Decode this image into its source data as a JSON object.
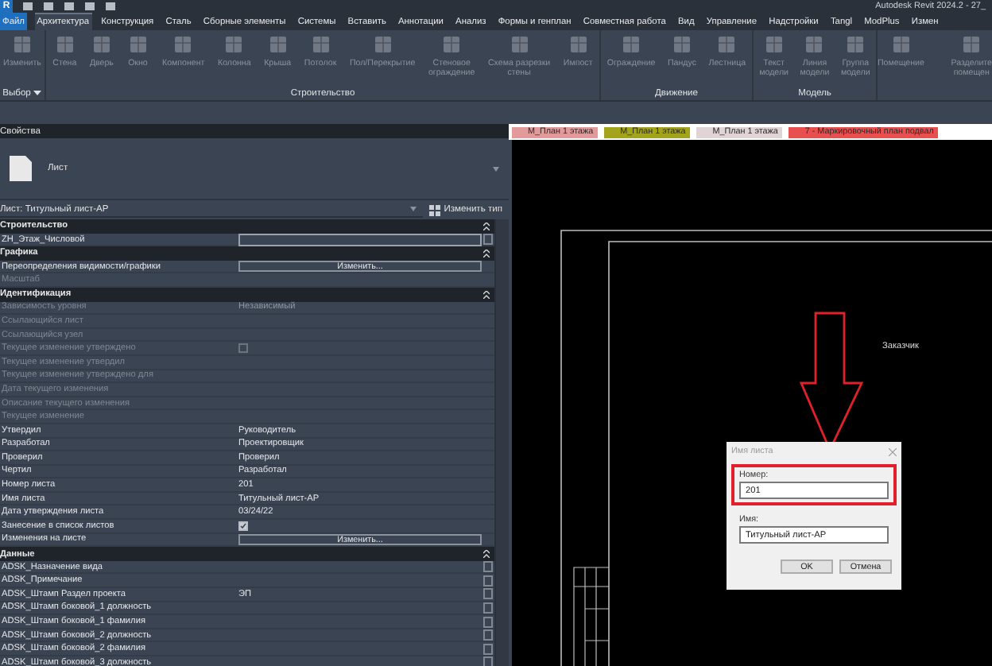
{
  "title_bar": {
    "logo": "R",
    "title": "Autodesk Revit 2024.2 - 27_"
  },
  "menu_tabs": [
    {
      "label": "Файл",
      "kind": "file",
      "selected": false
    },
    {
      "label": "Архитектура",
      "kind": "tab",
      "selected": true
    },
    {
      "label": "Конструкция",
      "kind": "tab",
      "selected": false
    },
    {
      "label": "Сталь",
      "kind": "tab",
      "selected": false
    },
    {
      "label": "Сборные элементы",
      "kind": "tab",
      "selected": false
    },
    {
      "label": "Системы",
      "kind": "tab",
      "selected": false
    },
    {
      "label": "Вставить",
      "kind": "tab",
      "selected": false
    },
    {
      "label": "Аннотации",
      "kind": "tab",
      "selected": false
    },
    {
      "label": "Анализ",
      "kind": "tab",
      "selected": false
    },
    {
      "label": "Формы и генплан",
      "kind": "tab",
      "selected": false
    },
    {
      "label": "Совместная работа",
      "kind": "tab",
      "selected": false
    },
    {
      "label": "Вид",
      "kind": "tab",
      "selected": false
    },
    {
      "label": "Управление",
      "kind": "tab",
      "selected": false
    },
    {
      "label": "Надстройки",
      "kind": "tab",
      "selected": false
    },
    {
      "label": "Tangl",
      "kind": "tab",
      "selected": false
    },
    {
      "label": "ModPlus",
      "kind": "tab",
      "selected": false
    },
    {
      "label": "Измен",
      "kind": "tab",
      "selected": false
    }
  ],
  "ribbon": {
    "panels": [
      {
        "label": "Выбор",
        "dropdown": true,
        "tools": [
          "Изменить"
        ]
      },
      {
        "label": "Строительство",
        "tools": [
          "Стена",
          "Дверь",
          "Окно",
          "Компонент",
          "Колонна",
          "Крыша",
          "Потолок",
          "Пол/Перекрытие",
          "Стеновое\nограждение",
          "Схема разрезки\nстены",
          "Импост"
        ]
      },
      {
        "label": "Движение",
        "tools": [
          "Ограждение",
          "Пандус",
          "Лестница"
        ]
      },
      {
        "label": "Модель",
        "tools": [
          "Текст\nмодели",
          "Линия\nмодели",
          "Группа\nмодели"
        ]
      },
      {
        "tools": [
          "Помещение",
          "Разделите\nпомещен"
        ]
      }
    ]
  },
  "properties": {
    "title": "Свойства",
    "type_name": "Лист",
    "instance_selector": "Лист: Титульный лист-АР",
    "edit_type": "Изменить тип",
    "rows": [
      {
        "kind": "section",
        "label": "Строительство"
      },
      {
        "kind": "input",
        "label": "ZH_Этаж_Числовой",
        "disabled": false
      },
      {
        "kind": "section",
        "label": "Графика"
      },
      {
        "kind": "button",
        "label": "Переопределения видимости/графики",
        "button": "Изменить...",
        "disabled": false
      },
      {
        "kind": "text",
        "label": "Масштаб",
        "disabled": true
      },
      {
        "kind": "section",
        "label": "Идентификация"
      },
      {
        "kind": "text",
        "label": "Зависимость уровня",
        "value": "Независимый",
        "disabled": true
      },
      {
        "kind": "text",
        "label": "Ссылающийся лист",
        "disabled": true
      },
      {
        "kind": "text",
        "label": "Ссылающийся узел",
        "disabled": true
      },
      {
        "kind": "checkbox",
        "label": "Текущее изменение утверждено",
        "checked": false,
        "disabled": true
      },
      {
        "kind": "text",
        "label": "Текущее изменение утвердил",
        "disabled": true
      },
      {
        "kind": "text",
        "label": "Текущее изменение утверждено для",
        "disabled": true
      },
      {
        "kind": "text",
        "label": "Дата текущего изменения",
        "disabled": true
      },
      {
        "kind": "text",
        "label": "Описание текущего изменения",
        "disabled": true
      },
      {
        "kind": "text",
        "label": "Текущее изменение",
        "disabled": true
      },
      {
        "kind": "text",
        "label": "Утвердил",
        "value": "Руководитель",
        "disabled": false
      },
      {
        "kind": "text",
        "label": "Разработал",
        "value": "Проектировщик",
        "disabled": false
      },
      {
        "kind": "text",
        "label": "Проверил",
        "value": "Проверил",
        "disabled": false
      },
      {
        "kind": "text",
        "label": "Чертил",
        "value": "Разработал",
        "disabled": false
      },
      {
        "kind": "text",
        "label": "Номер листа",
        "value": "201",
        "disabled": false
      },
      {
        "kind": "text",
        "label": "Имя листа",
        "value": "Титульный лист-АР",
        "disabled": false
      },
      {
        "kind": "text",
        "label": "Дата утверждения листа",
        "value": "03/24/22",
        "disabled": false
      },
      {
        "kind": "checkbox",
        "label": "Занесение в список листов",
        "checked": true,
        "disabled": false
      },
      {
        "kind": "button",
        "label": "Изменения на листе",
        "button": "Изменить...",
        "disabled": false
      },
      {
        "kind": "section",
        "label": "Данные"
      },
      {
        "kind": "data",
        "label": "ADSK_Назначение вида",
        "disabled": false
      },
      {
        "kind": "data",
        "label": "ADSK_Примечание",
        "disabled": false
      },
      {
        "kind": "data",
        "label": "ADSK_Штамп Раздел проекта",
        "value": "ЭП",
        "disabled": false
      },
      {
        "kind": "data",
        "label": "ADSK_Штамп боковой_1 должность",
        "disabled": false
      },
      {
        "kind": "data",
        "label": "ADSK_Штамп боковой_1 фамилия",
        "disabled": false
      },
      {
        "kind": "data",
        "label": "ADSK_Штамп боковой_2 должность",
        "disabled": false
      },
      {
        "kind": "data",
        "label": "ADSK_Штамп боковой_2 фамилия",
        "disabled": false
      },
      {
        "kind": "data",
        "label": "ADSK_Штамп боковой_3 должность",
        "disabled": false
      }
    ]
  },
  "view_tabs": [
    {
      "label": "М_План 1 этажа",
      "color": "#e39a9a"
    },
    {
      "label": "М_План 1 этажа",
      "color": "#a3a31c"
    },
    {
      "label": "М_План 1 этажа",
      "color": "#e0d4d4"
    },
    {
      "label": "7 - Маркировочный план подвал",
      "color": "#e85050"
    }
  ],
  "sheet": {
    "text": "Заказчик"
  },
  "dialog": {
    "title": "Имя листа",
    "fields": [
      {
        "label": "Номер:",
        "value": "201",
        "highlighted": true
      },
      {
        "label": "Имя:",
        "value": "Титульный лист-АР",
        "highlighted": false
      }
    ],
    "buttons": [
      "OK",
      "Отмена"
    ]
  }
}
